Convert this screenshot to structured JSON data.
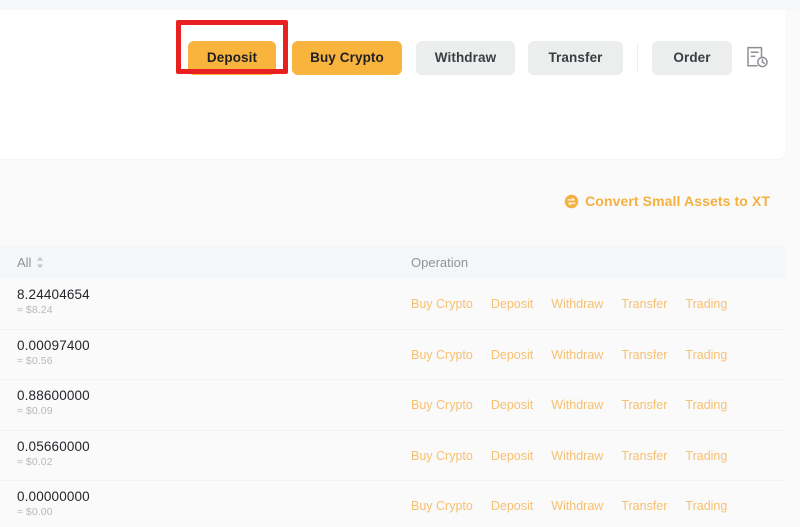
{
  "theme": {
    "accent_orange": "#f9b43d",
    "link_orange": "#f7c070",
    "convert_orange": "#f5b040",
    "highlight_red": "#e8201f",
    "button_grey": "#eceded",
    "page_background": "#fafafa",
    "table_header_background": "#f5f6f7"
  },
  "action_bar": {
    "deposit_label": "Deposit",
    "buy_crypto_label": "Buy Crypto",
    "withdraw_label": "Withdraw",
    "transfer_label": "Transfer",
    "order_label": "Order",
    "order_history_icon": "order-history-icon"
  },
  "convert": {
    "icon": "convert-icon",
    "label": "Convert Small Assets to XT"
  },
  "table": {
    "columns": {
      "all": "All",
      "sort_icon": "sort-icon",
      "operation": "Operation"
    },
    "operations": [
      "Buy Crypto",
      "Deposit",
      "Withdraw",
      "Transfer",
      "Trading"
    ],
    "rows": [
      {
        "amount": "8.24404654",
        "usd": "≈ $8.24"
      },
      {
        "amount": "0.00097400",
        "usd": "≈ $0.56"
      },
      {
        "amount": "0.88600000",
        "usd": "≈ $0.09"
      },
      {
        "amount": "0.05660000",
        "usd": "≈ $0.02"
      },
      {
        "amount": "0.00000000",
        "usd": "≈ $0.00"
      }
    ]
  }
}
